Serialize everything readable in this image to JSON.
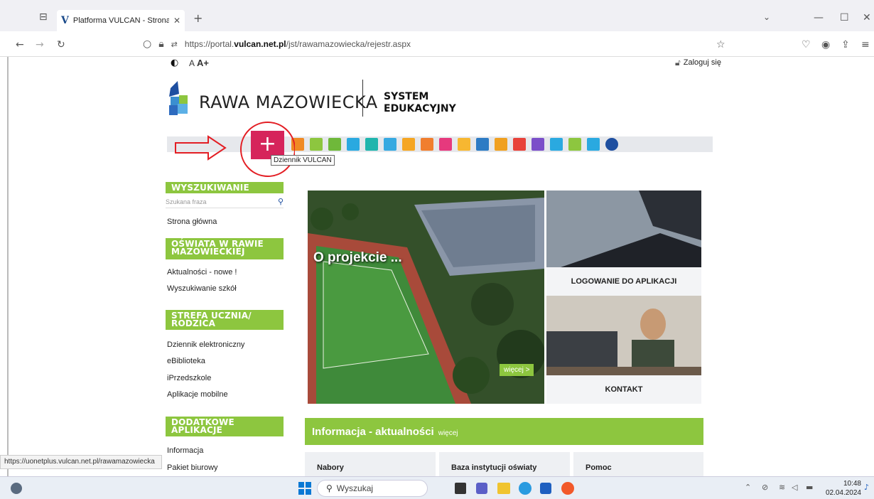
{
  "browser": {
    "tab_title": "Platforma VULCAN - Strona głó",
    "new_tab_glyph": "+",
    "url_prefix": "https://portal.",
    "url_domain": "vulcan.net.pl",
    "url_path": "/jst/rawamazowiecka/rejestr.aspx"
  },
  "page": {
    "font_size_a": "A",
    "font_size_a_plus": "A+",
    "login": "Zaloguj się",
    "logo_text": "RAWA MAZOWIECKA",
    "system_line1": "SYSTEM",
    "system_line2": "EDUKACYJNY",
    "tooltip": "Dziennik VULCAN",
    "sidebar": {
      "search_heading": "WYSZUKIWANIE",
      "search_placeholder": "Szukana fraza",
      "home": "Strona główna",
      "education_heading_line1": "OŚWIATA W RAWIE",
      "education_heading_line2": "MAZOWIECKIEJ",
      "news": "Aktualności - nowe !",
      "school_search": "Wyszukiwanie szkół",
      "student_heading_line1": "STREFA UCZNIA/",
      "student_heading_line2": "RODZICA",
      "student_items": [
        "Dziennik elektroniczny",
        "eBiblioteka",
        "iPrzedszkole",
        "Aplikacje mobilne"
      ],
      "apps_heading_line1": "DODATKOWE",
      "apps_heading_line2": "APLIKACJE",
      "apps_items": [
        "Informacja",
        "Pakiet biurowy"
      ]
    },
    "hero": {
      "title": "O projekcie ...",
      "more": "więcej >"
    },
    "cards": {
      "login_apps": "LOGOWANIE DO APLIKACJI",
      "contact": "KONTAKT"
    },
    "news_bar": {
      "title": "Informacja - aktualności",
      "more": "więcej"
    },
    "bottom_boxes": [
      "Nabory",
      "Baza instytucji oświaty",
      "Pomoc"
    ]
  },
  "status_url": "https://uonetplus.vulcan.net.pl/rawamazowiecka",
  "taskbar": {
    "search": "Wyszukaj",
    "time": "10:48",
    "date": "02.04.2024"
  },
  "colors": {
    "green": "#8dc63f",
    "vulcan_red": "#d6245b",
    "annotation_red": "#e31e24"
  }
}
